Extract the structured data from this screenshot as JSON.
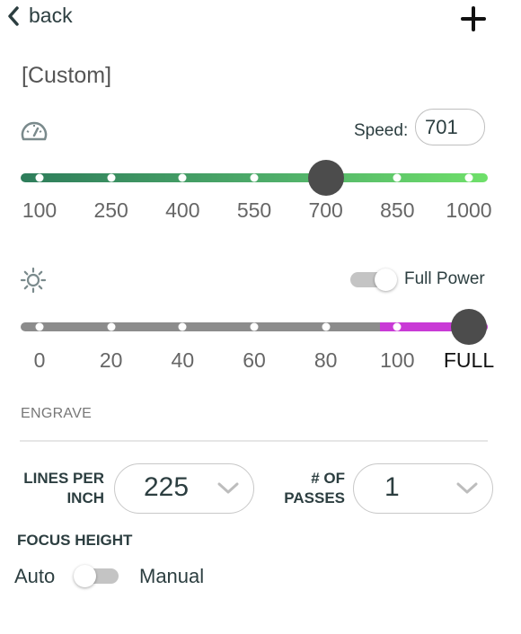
{
  "header": {
    "back_label": "back",
    "add_icon": "plus-icon"
  },
  "profile": {
    "name": "[Custom]"
  },
  "speed": {
    "label": "Speed:",
    "value": "701",
    "ticks": [
      "100",
      "250",
      "400",
      "550",
      "700",
      "850",
      "1000"
    ],
    "current": 701,
    "min": 100,
    "max": 1000,
    "icon": "speedometer-icon",
    "colors": {
      "start": "#2e7d5b",
      "end": "#6fe06a"
    }
  },
  "power": {
    "toggle_label": "Full Power",
    "toggle_on": true,
    "ticks": [
      "0",
      "20",
      "40",
      "60",
      "80",
      "100",
      "FULL"
    ],
    "current": "FULL",
    "icon": "sun-icon",
    "colors": {
      "track": "#8c8c8c",
      "full_segment": "#c93ad6"
    }
  },
  "engrave": {
    "section_label": "ENGRAVE",
    "lines_per_inch": {
      "label_line1": "LINES PER",
      "label_line2": "INCH",
      "value": "225"
    },
    "passes": {
      "label_line1": "# OF",
      "label_line2": "PASSES",
      "value": "1"
    }
  },
  "focus": {
    "label": "FOCUS HEIGHT",
    "left_option": "Auto",
    "right_option": "Manual",
    "selected": "Auto"
  }
}
